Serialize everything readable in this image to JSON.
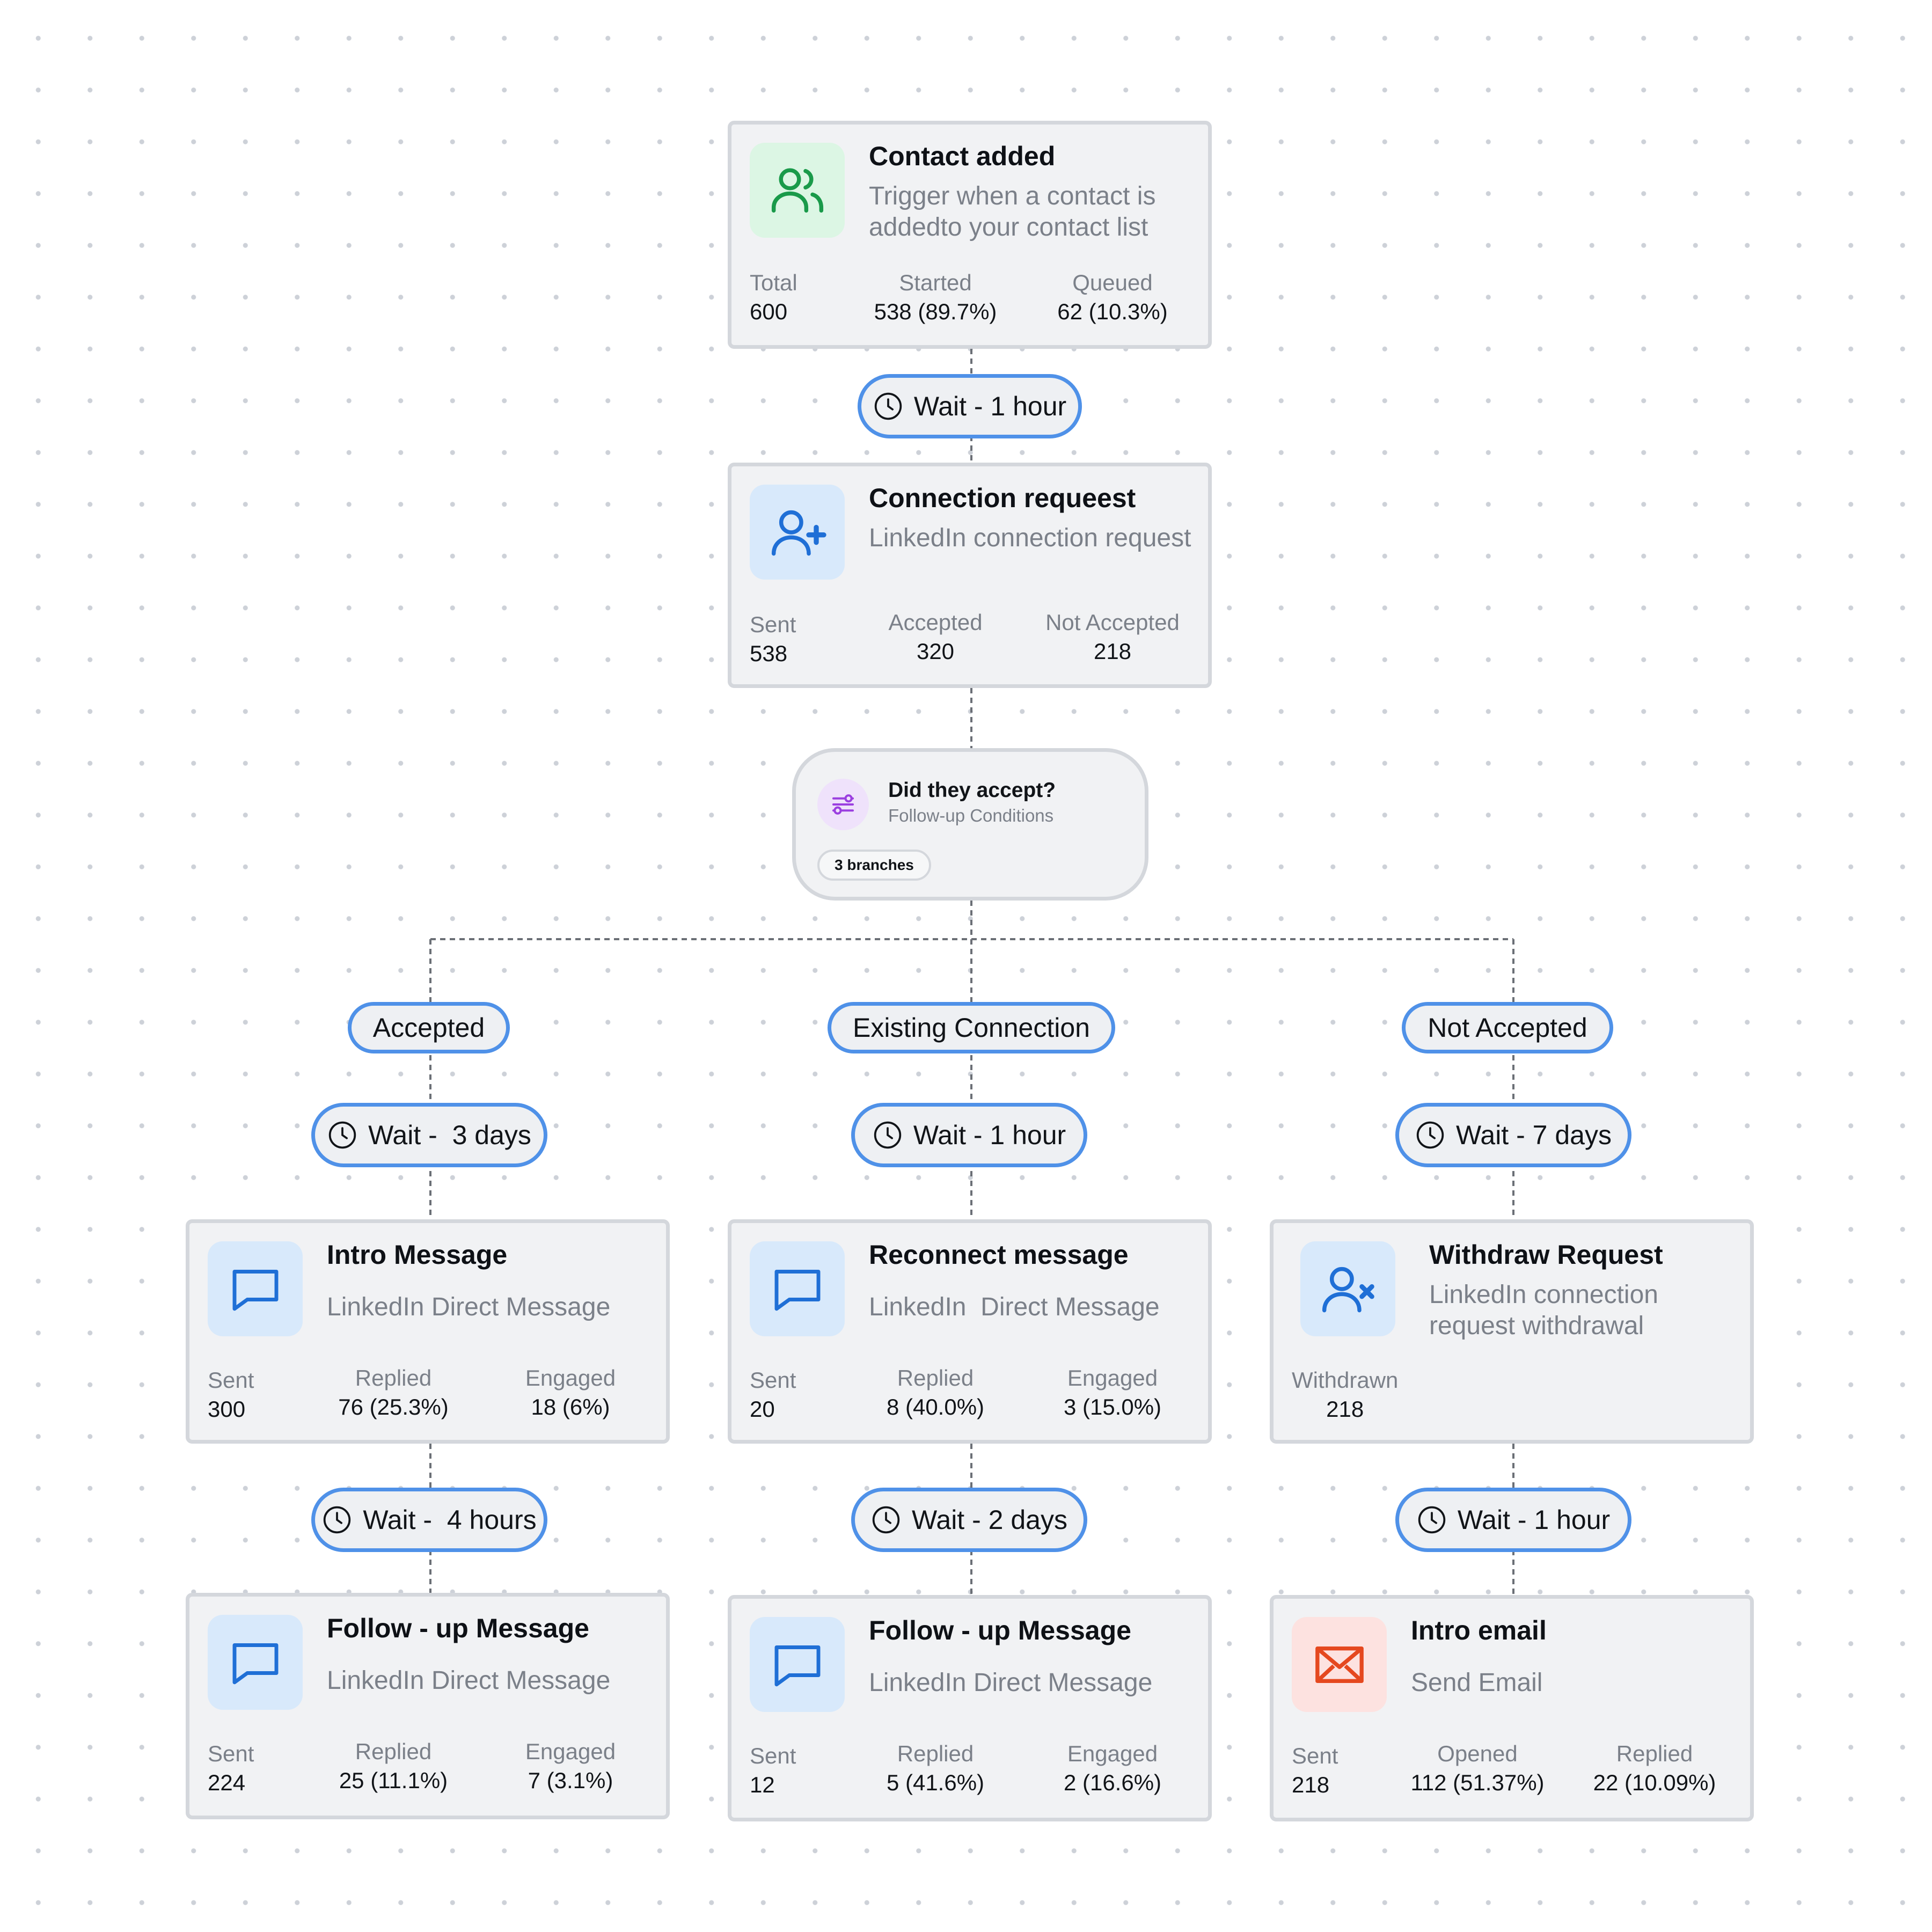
{
  "colors": {
    "pill_border": "#4f91e8",
    "icon_blue": "#1f6fd6",
    "icon_green": "#1a9a4a",
    "icon_red": "#e5481f",
    "icon_purple": "#9b3fe0",
    "muted_text": "#7b8089"
  },
  "trigger": {
    "title": "Contact added",
    "subtitle": "Trigger when a contact is addedto your contact list",
    "icon": "users-icon",
    "stats": [
      {
        "label": "Total",
        "value": "600"
      },
      {
        "label": "Started",
        "value": "538 (89.7%)"
      },
      {
        "label": "Queued",
        "value": "62 (10.3%)"
      }
    ]
  },
  "wait_1": "Wait - 1 hour",
  "connection": {
    "title": "Connection requeest",
    "subtitle": "LinkedIn connection request",
    "icon": "user-plus-icon",
    "stats": [
      {
        "label": "Sent",
        "value": "538"
      },
      {
        "label": "Accepted",
        "value": "320"
      },
      {
        "label": "Not Accepted",
        "value": "218"
      }
    ]
  },
  "condition": {
    "title": "Did they accept?",
    "subtitle": "Follow-up Conditions",
    "badge": "3 branches",
    "icon": "branch-sliders-icon"
  },
  "branches": [
    {
      "label": "Accepted",
      "wait_a": "Wait -  3 days",
      "step1": {
        "title": "Intro Message",
        "subtitle": "LinkedIn Direct Message",
        "icon": "message-icon",
        "stats": [
          {
            "label": "Sent",
            "value": "300"
          },
          {
            "label": "Replied",
            "value": "76 (25.3%)"
          },
          {
            "label": "Engaged",
            "value": "18 (6%)"
          }
        ]
      },
      "wait_b": "Wait -  4 hours",
      "step2": {
        "title": "Follow - up Message",
        "subtitle": "LinkedIn Direct Message",
        "icon": "message-icon",
        "stats": [
          {
            "label": "Sent",
            "value": "224"
          },
          {
            "label": "Replied",
            "value": "25 (11.1%)"
          },
          {
            "label": "Engaged",
            "value": "7 (3.1%)"
          }
        ]
      }
    },
    {
      "label": "Existing Connection",
      "wait_a": "Wait - 1 hour",
      "step1": {
        "title": "Reconnect message",
        "subtitle": "LinkedIn  Direct Message",
        "icon": "message-icon",
        "stats": [
          {
            "label": "Sent",
            "value": "20"
          },
          {
            "label": "Replied",
            "value": "8 (40.0%)"
          },
          {
            "label": "Engaged",
            "value": "3 (15.0%)"
          }
        ]
      },
      "wait_b": "Wait - 2 days",
      "step2": {
        "title": "Follow - up Message",
        "subtitle": "LinkedIn Direct Message",
        "icon": "message-icon",
        "stats": [
          {
            "label": "Sent",
            "value": "12"
          },
          {
            "label": "Replied",
            "value": "5 (41.6%)"
          },
          {
            "label": "Engaged",
            "value": "2 (16.6%)"
          }
        ]
      }
    },
    {
      "label": "Not Accepted",
      "wait_a": "Wait - 7 days",
      "step1": {
        "title": "Withdraw Request",
        "subtitle": "LinkedIn connection request withdrawal",
        "icon": "user-x-icon",
        "stats": [
          {
            "label": "Withdrawn",
            "value": "218"
          }
        ]
      },
      "wait_b": "Wait - 1 hour",
      "step2": {
        "title": "Intro email",
        "subtitle": "Send Email",
        "icon": "envelope-icon",
        "stats": [
          {
            "label": "Sent",
            "value": "218"
          },
          {
            "label": "Opened",
            "value": "112 (51.37%)"
          },
          {
            "label": "Replied",
            "value": "22 (10.09%)"
          }
        ]
      }
    }
  ]
}
